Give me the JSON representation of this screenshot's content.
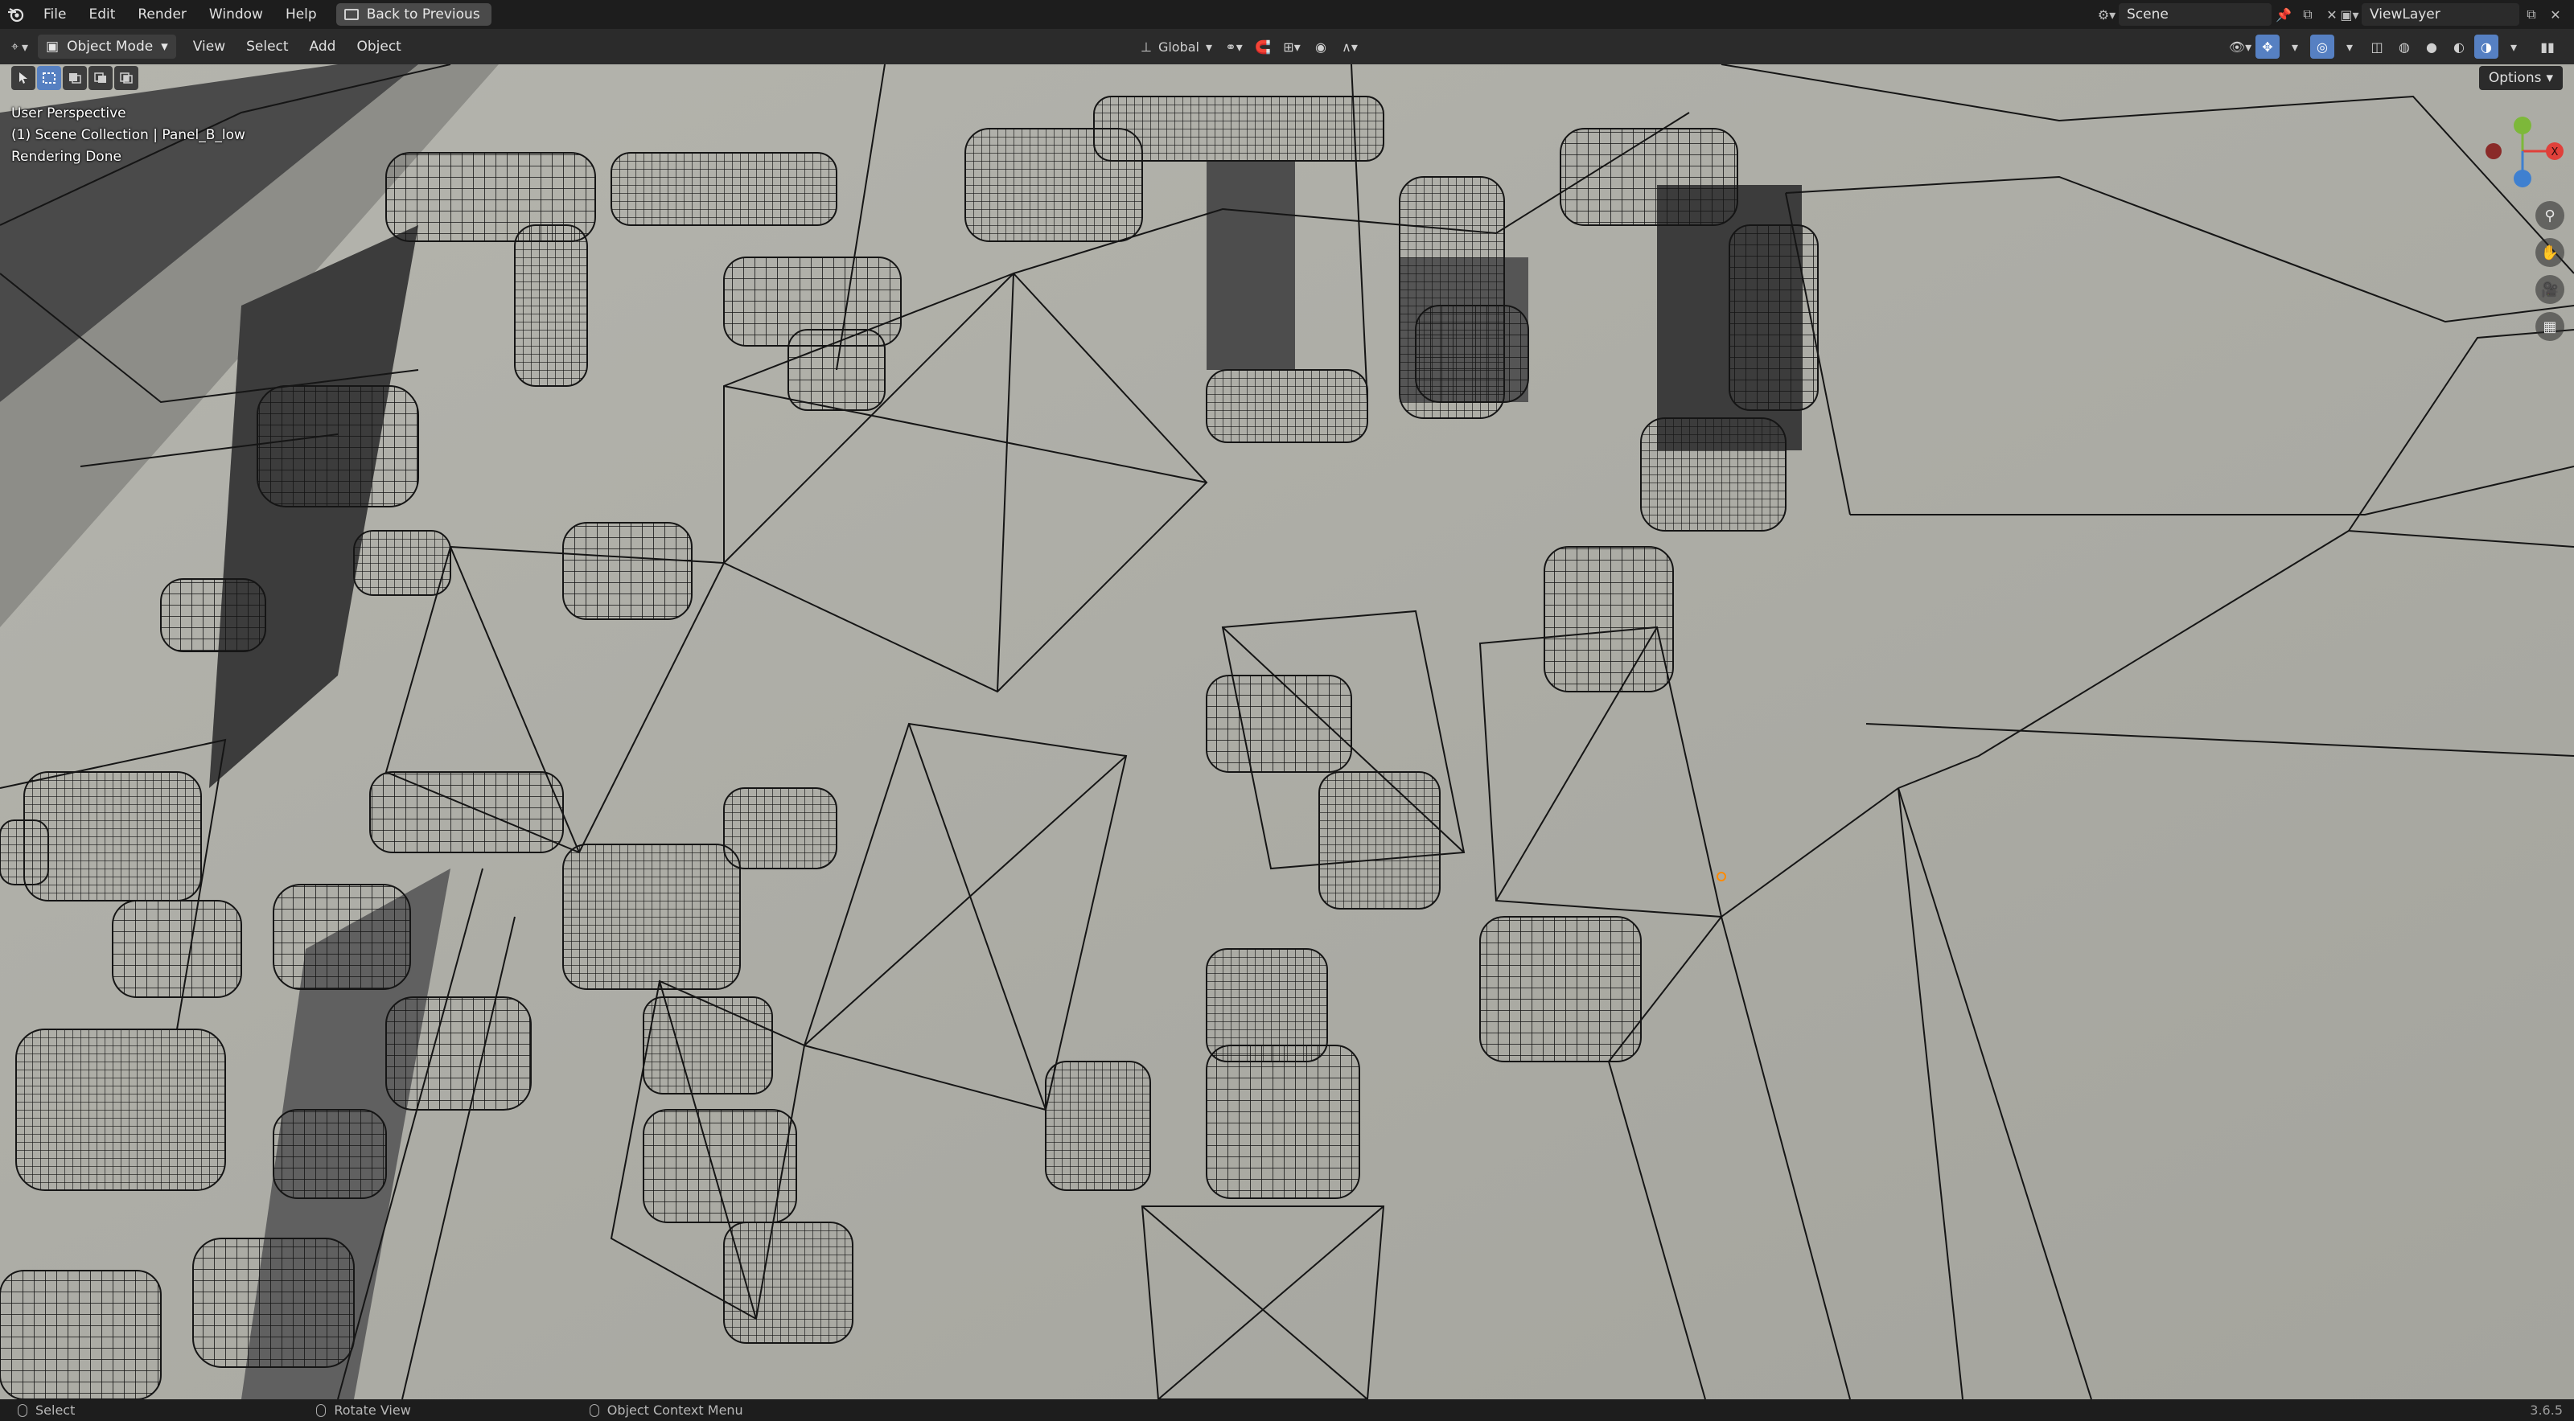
{
  "topbar": {
    "menus": [
      "File",
      "Edit",
      "Render",
      "Window",
      "Help"
    ],
    "back_label": "Back to Previous",
    "scene_name": "Scene",
    "view_layer": "ViewLayer"
  },
  "header": {
    "mode": "Object Mode",
    "menus": [
      "View",
      "Select",
      "Add",
      "Object"
    ],
    "transform_orientation": "Global",
    "options_label": "Options"
  },
  "viewport": {
    "perspective": "User Perspective",
    "collection": "(1) Scene Collection | Panel_B_low",
    "status": "Rendering Done",
    "gizmo": {
      "x": "X",
      "y": "Y",
      "z": "Z"
    }
  },
  "statusbar": {
    "select": "Select",
    "rotate": "Rotate View",
    "context_menu": "Object Context Menu",
    "version": "3.6.5"
  },
  "colors": {
    "accent": "#5680c2",
    "viewport_bg": "#a9a9a2",
    "wire": "#151515",
    "x_axis": "#e0403a",
    "y_axis": "#7db83a",
    "z_axis": "#3f80d0"
  }
}
